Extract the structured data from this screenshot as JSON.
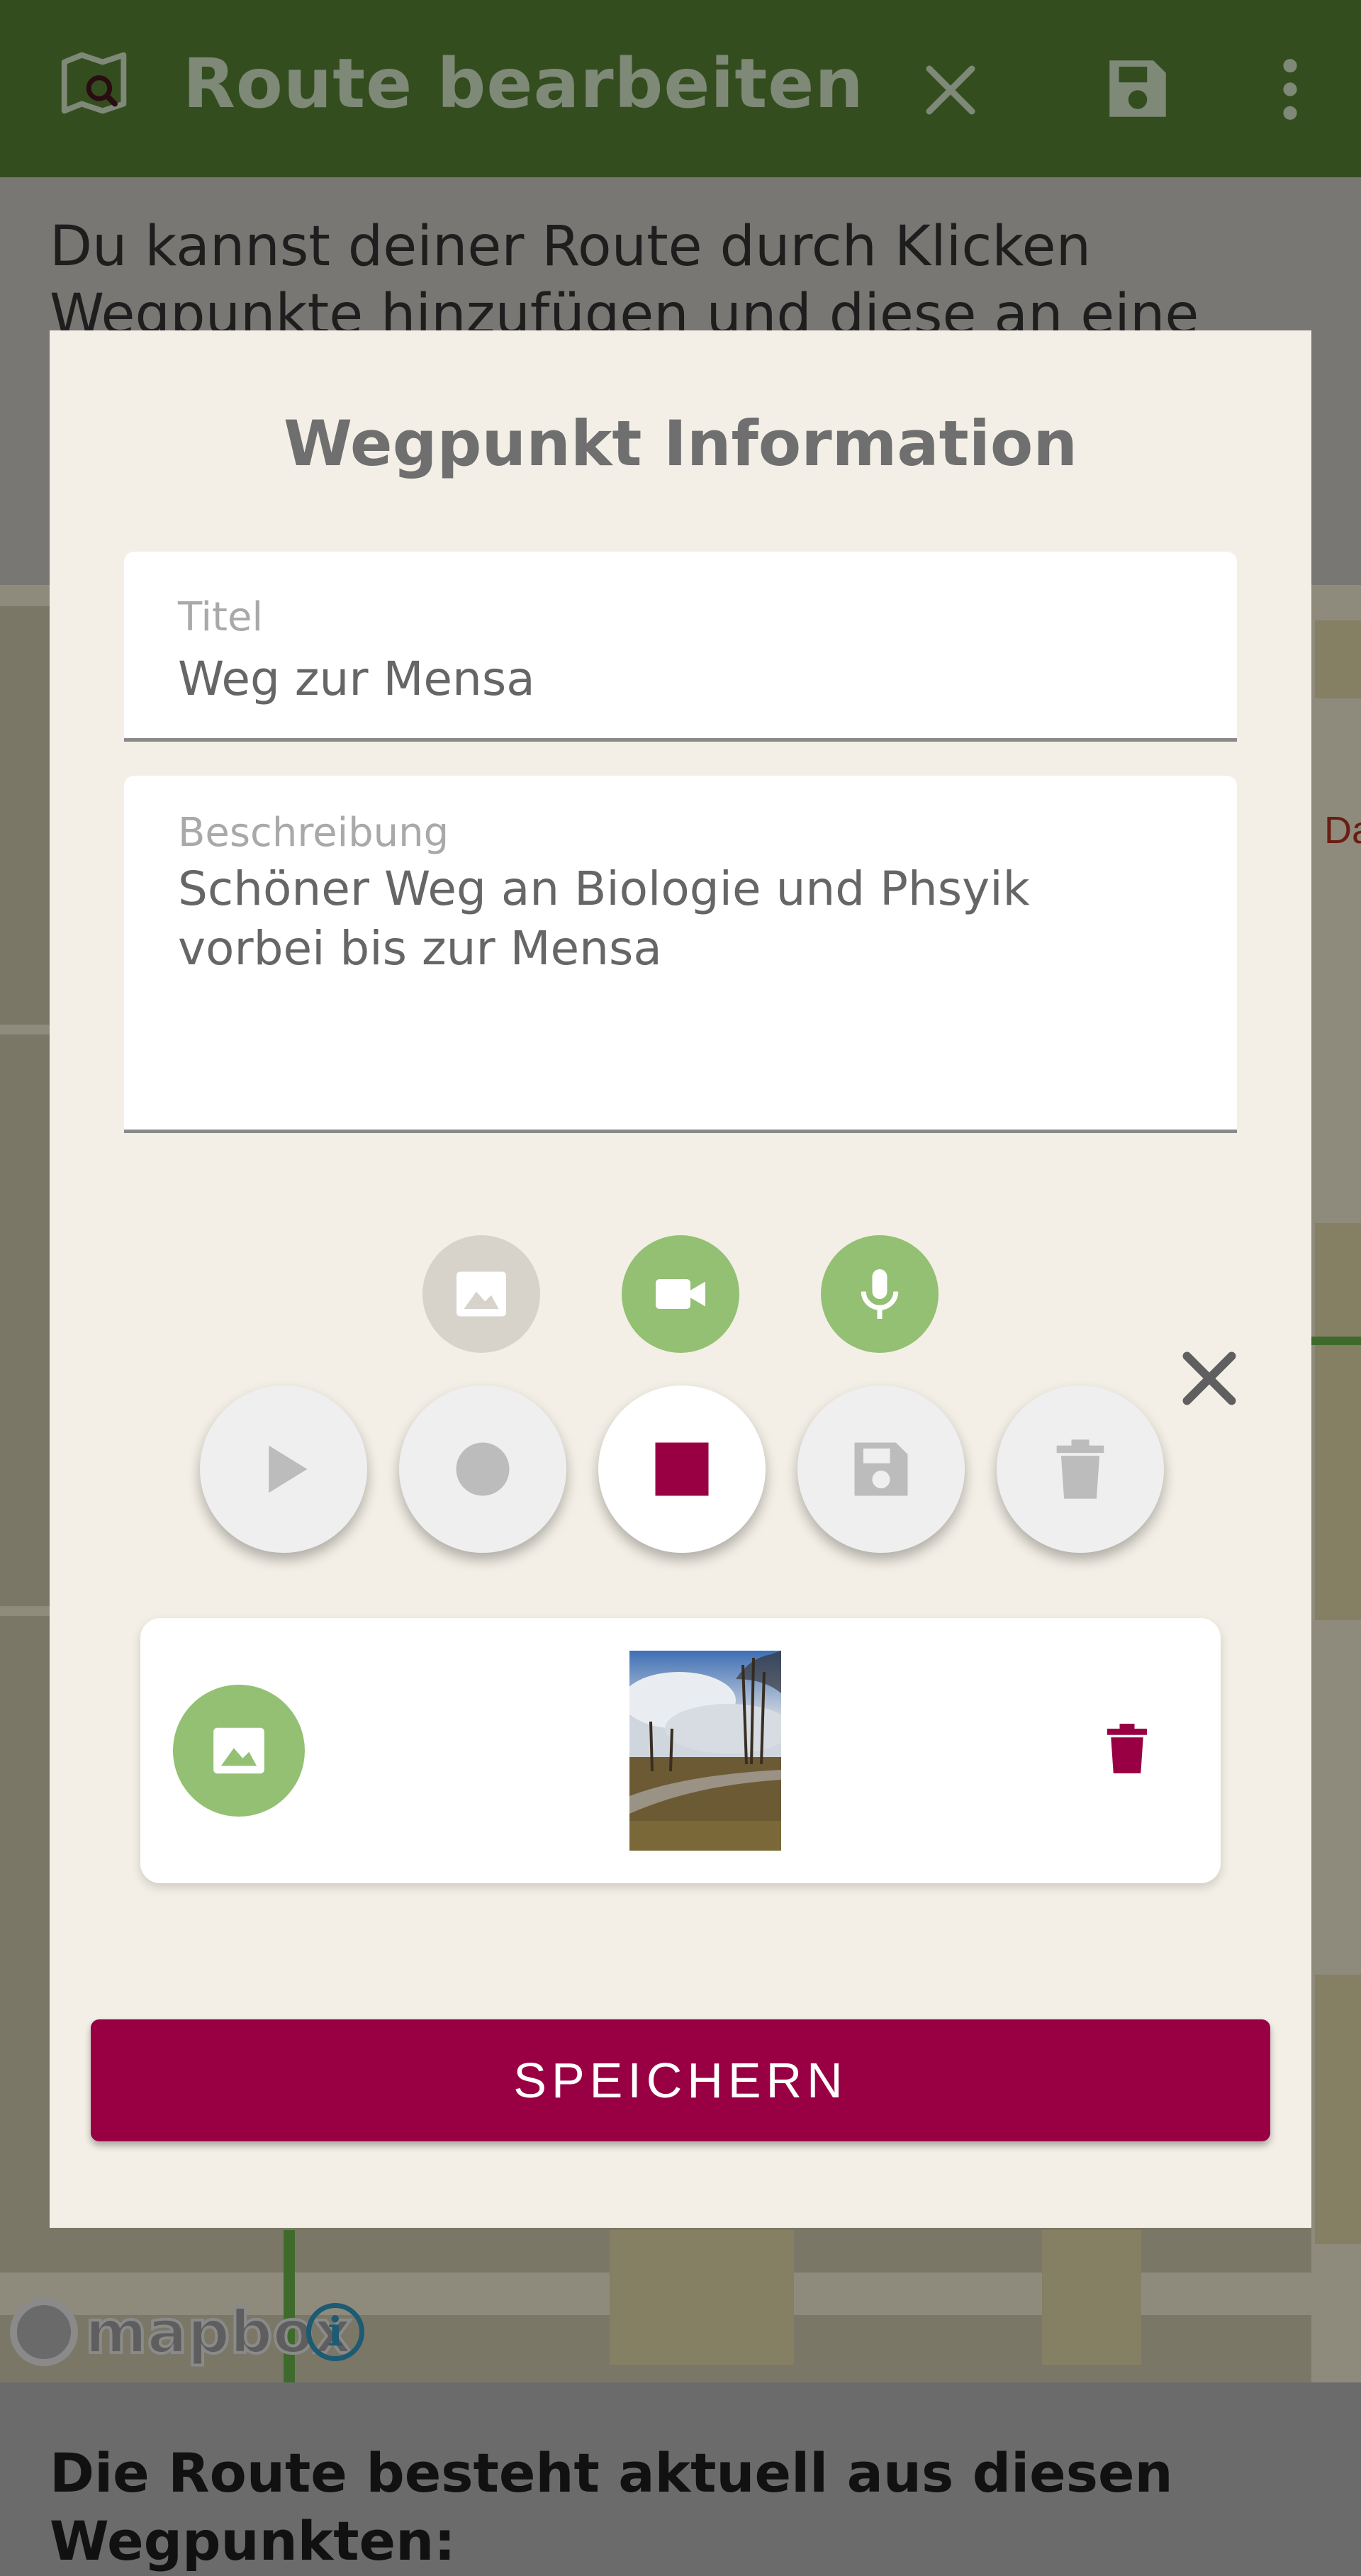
{
  "appbar": {
    "title": "Route bearbeiten",
    "icons": [
      "map-search-icon",
      "close-icon",
      "save-icon",
      "more-vert-icon"
    ],
    "color": "#344d1f"
  },
  "info": {
    "text": "Du kannst deiner Route durch Klicken Wegpunkte hinzufügen und diese an eine neue Position"
  },
  "map": {
    "attribution": "mapbox",
    "label_fragment": "Da"
  },
  "bottom": {
    "heading": "Die Route besteht aktuell aus diesen Wegpunkten:"
  },
  "dialog": {
    "title": "Wegpunkt Information",
    "title_field": {
      "label": "Titel",
      "value": "Weg zur Mensa"
    },
    "description_field": {
      "label": "Beschreibung",
      "value": "Schöner Weg an Biologie und Phsyik vorbei bis zur Mensa"
    },
    "media_buttons": [
      {
        "name": "image-icon",
        "state": "disabled",
        "color": "#d7d3cb"
      },
      {
        "name": "video-camera-icon",
        "state": "enabled",
        "color": "#93c072"
      },
      {
        "name": "microphone-icon",
        "state": "enabled",
        "color": "#93c072"
      }
    ],
    "recorder_controls": [
      {
        "name": "play-icon",
        "state": "disabled"
      },
      {
        "name": "record-icon",
        "state": "disabled"
      },
      {
        "name": "stop-icon",
        "state": "active"
      },
      {
        "name": "save-icon",
        "state": "disabled"
      },
      {
        "name": "delete-icon",
        "state": "disabled"
      }
    ],
    "attachment": {
      "type_icon": "image-icon",
      "thumbnail": "photo of path with trees and cloudy sky",
      "delete_icon": "delete-icon"
    },
    "save_label": "SPEICHERN"
  },
  "colors": {
    "accent": "#990044",
    "green": "#93c072",
    "dialog_bg": "#f3efe6"
  }
}
